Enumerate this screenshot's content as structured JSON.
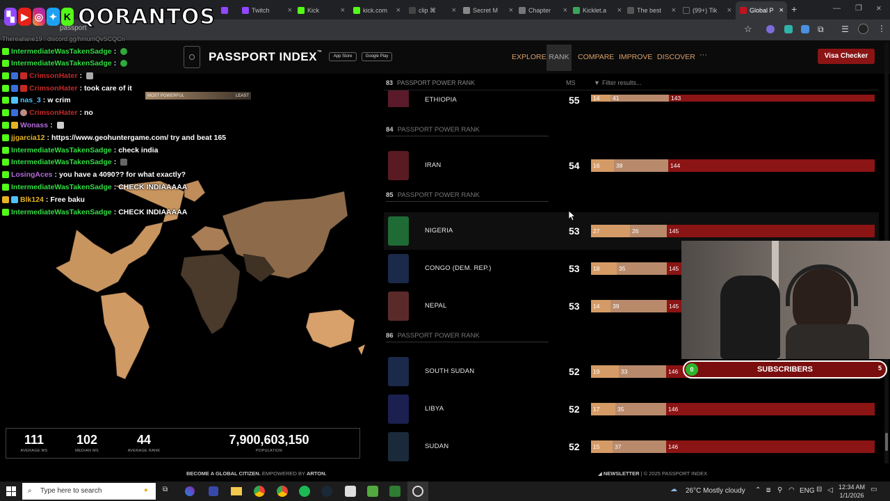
{
  "browser": {
    "tabs": [
      {
        "label": "",
        "color": "#9147ff"
      },
      {
        "label": "Twitch",
        "color": "#9147ff"
      },
      {
        "label": "Kick",
        "color": "#53fc18"
      },
      {
        "label": "kick.com",
        "color": "#53fc18"
      },
      {
        "label": "clip ⌘",
        "color": "#444444"
      },
      {
        "label": "Secret M",
        "color": "#888888"
      },
      {
        "label": "Chapter",
        "color": "#777777"
      },
      {
        "label": "Kicklet.a",
        "color": "#3aa55c"
      },
      {
        "label": "The best",
        "color": "#555555"
      },
      {
        "label": "(99+) Tik",
        "color": "#222222"
      },
      {
        "label": "Global P",
        "color": "#c1121f"
      }
    ],
    "url_partial": "passport"
  },
  "stream": {
    "channel_name": "QORANTOS",
    "social_icons": [
      "twitch-icon",
      "youtube-icon",
      "instagram-icon",
      "twitter-icon",
      "kick-icon"
    ],
    "chat_partial_top": "Thereallane19 : discord.gg/hmumQvSCQCn",
    "chat": [
      {
        "user": "IntermediateWasTakenSadge",
        "message": "",
        "emote": true
      },
      {
        "user": "IntermediateWasTakenSadge",
        "message": "",
        "emote": true
      },
      {
        "user": "CrimsonHater",
        "message": "",
        "emote": true
      },
      {
        "user": "CrimsonHater",
        "message": "took care of it",
        "emote": false
      },
      {
        "user": "nas_3",
        "message": "w crim",
        "emote": false
      },
      {
        "user": "CrimsonHater",
        "message": "no",
        "emote": false
      },
      {
        "user": "Wonass",
        "message": "",
        "emote": true
      },
      {
        "user": "jjgarcia12",
        "message": "https://www.geohuntergame.com/ try and beat 165",
        "emote": false
      },
      {
        "user": "IntermediateWasTakenSadge",
        "message": "check india",
        "emote": false
      },
      {
        "user": "IntermediateWasTakenSadge",
        "message": "",
        "emote": true
      },
      {
        "user": "LosingAces",
        "message": "you have a 4090?? for what exactly?",
        "emote": false
      },
      {
        "user": "IntermediateWasTakenSadge",
        "message": "CHECK INDIAAAAA",
        "emote": false
      },
      {
        "user": "Blk124",
        "message": "Free baku",
        "emote": false
      },
      {
        "user": "IntermediateWasTakenSadge",
        "message": "CHECK INDIAAAAA",
        "emote": false
      }
    ],
    "subscribers": {
      "label": "SUBSCRIBERS",
      "current": "0",
      "goal": "5"
    }
  },
  "site": {
    "logo": "PASSPORT INDEX",
    "tm": "™",
    "app_store": "App Store",
    "google_play": "Google Play",
    "nav": [
      "EXPLORE",
      "RANK",
      "COMPARE",
      "IMPROVE",
      "DISCOVER"
    ],
    "active_nav": "RANK",
    "more": "···",
    "visa_checker": "Visa Checker"
  },
  "map": {
    "legend_left": "MOST POWERFUL",
    "legend_right": "LEAST",
    "stats": [
      {
        "value": "111",
        "label": "AVERAGE MS"
      },
      {
        "value": "102",
        "label": "MEDIAN MS"
      },
      {
        "value": "44",
        "label": "AVERAGE RANK"
      },
      {
        "value": "7,900,603,150",
        "label": "POPULATION"
      }
    ]
  },
  "ranking": {
    "header": {
      "rank": "83",
      "label": "PASSPORT POWER RANK",
      "ms": "MS",
      "filter_placeholder": "Filter results..."
    },
    "group_label": "PASSPORT POWER RANK",
    "groups": [
      {
        "rank": "84"
      },
      {
        "rank": "85"
      },
      {
        "rank": "86"
      }
    ],
    "rows": [
      {
        "country": "ETHIOPIA",
        "score": "55",
        "visa_free": "14",
        "visa_on_arrival": "41",
        "visa_required": "143",
        "color": "#5a1a2a"
      },
      {
        "country": "IRAN",
        "score": "54",
        "visa_free": "16",
        "visa_on_arrival": "38",
        "visa_required": "144",
        "color": "#5a1a22"
      },
      {
        "country": "NIGERIA",
        "score": "53",
        "visa_free": "27",
        "visa_on_arrival": "26",
        "visa_required": "145",
        "color": "#1f6b35"
      },
      {
        "country": "CONGO (DEM. REP.)",
        "score": "53",
        "visa_free": "18",
        "visa_on_arrival": "35",
        "visa_required": "145",
        "color": "#1b2a4a"
      },
      {
        "country": "NEPAL",
        "score": "53",
        "visa_free": "14",
        "visa_on_arrival": "39",
        "visa_required": "145",
        "color": "#5a2a2a"
      },
      {
        "country": "SOUTH SUDAN",
        "score": "52",
        "visa_free": "19",
        "visa_on_arrival": "33",
        "visa_required": "146",
        "color": "#1b2a4a"
      },
      {
        "country": "LIBYA",
        "score": "52",
        "visa_free": "17",
        "visa_on_arrival": "35",
        "visa_required": "146",
        "color": "#1b2050"
      },
      {
        "country": "SUDAN",
        "score": "52",
        "visa_free": "15",
        "visa_on_arrival": "37",
        "visa_required": "146",
        "color": "#1b2a3a"
      }
    ]
  },
  "footer": {
    "left_prefix": "BECOME A GLOBAL CITIZEN.",
    "empowered": "EMPOWERED BY",
    "brand": "ARTON.",
    "newsletter": "NEWSLETTER",
    "copyright": "| © 2025 PASSPORT INDEX"
  },
  "taskbar": {
    "search_placeholder": "Type here to search",
    "weather": "26°C  Mostly cloudy",
    "language": "ENG",
    "time": "12:34 AM",
    "date": "1/1/2026"
  }
}
